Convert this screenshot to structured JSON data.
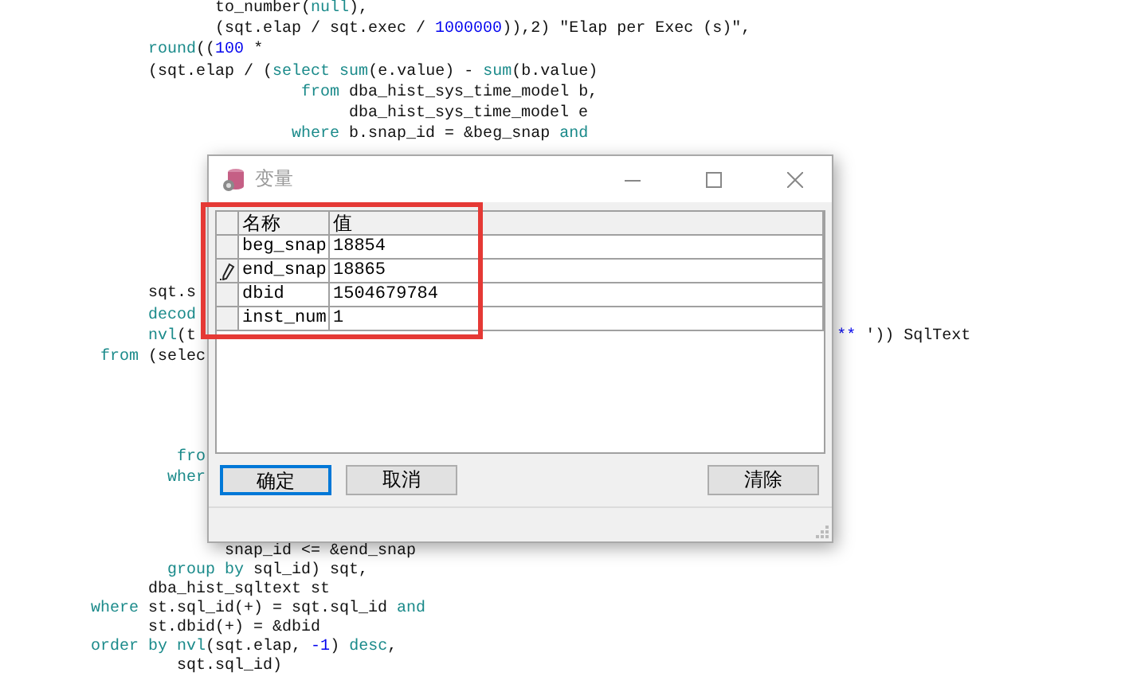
{
  "editor": {
    "blocks": [
      {
        "lines": [
          {
            "tokens": [
              {
                "t": "                     to_number(",
                "kind": "plain"
              },
              {
                "t": "null",
                "kind": "keyword"
              },
              {
                "t": "),",
                "kind": "plain"
              }
            ]
          },
          {
            "tokens": [
              {
                "t": "                     (sqt.elap / sqt.exec / ",
                "kind": "plain"
              },
              {
                "t": "1000000",
                "kind": "number"
              },
              {
                "t": ")),2) \"Elap per Exec (s)\",",
                "kind": "plain"
              }
            ]
          },
          {
            "tokens": [
              {
                "t": "              round",
                "kind": "keyword"
              },
              {
                "t": "((",
                "kind": "plain"
              },
              {
                "t": "100",
                "kind": "number"
              },
              {
                "t": " *",
                "kind": "plain"
              }
            ]
          },
          {
            "tokens": [
              {
                "t": "              (sqt.elap / (",
                "kind": "plain"
              },
              {
                "t": "select",
                "kind": "keyword"
              },
              {
                "t": " sum",
                "kind": "keyword"
              },
              {
                "t": "(e.value) - ",
                "kind": "plain"
              },
              {
                "t": "sum",
                "kind": "keyword"
              },
              {
                "t": "(b.value)",
                "kind": "plain"
              }
            ]
          },
          {
            "tokens": [
              {
                "t": "                              from",
                "kind": "keyword"
              },
              {
                "t": " dba_hist_sys_time_model b,",
                "kind": "plain"
              }
            ]
          },
          {
            "tokens": [
              {
                "t": "                                   dba_hist_sys_time_model e",
                "kind": "plain"
              }
            ]
          },
          {
            "tokens": [
              {
                "t": "                             where",
                "kind": "keyword"
              },
              {
                "t": " b.snap_id = &beg_snap ",
                "kind": "plain"
              },
              {
                "t": "and",
                "kind": "keyword"
              }
            ]
          }
        ]
      },
      {
        "lines": [
          {
            "tokens": [
              {
                "t": "              sqt.s",
                "kind": "plain"
              }
            ]
          },
          {
            "tokens": [
              {
                "t": "              decod",
                "kind": "keyword"
              }
            ]
          },
          {
            "tokens": [
              {
                "t": "              nvl",
                "kind": "keyword"
              },
              {
                "t": "(t",
                "kind": "plain"
              }
            ],
            "right": [
              {
                "t": "**",
                "kind": "number"
              },
              {
                "t": " ')) SqlText",
                "kind": "plain"
              }
            ]
          },
          {
            "tokens": [
              {
                "t": "         from",
                "kind": "keyword"
              },
              {
                "t": " (selec",
                "kind": "plain"
              }
            ]
          }
        ]
      },
      {
        "lines": [
          {
            "tokens": [
              {
                "t": "                 fro",
                "kind": "keyword"
              }
            ]
          },
          {
            "tokens": [
              {
                "t": "                wher",
                "kind": "keyword"
              }
            ]
          }
        ]
      },
      {
        "lines": [
          {
            "tokens": [
              {
                "t": "                      snap_id <= &end_snap",
                "kind": "plain"
              }
            ]
          },
          {
            "tokens": [
              {
                "t": "                group by",
                "kind": "keyword"
              },
              {
                "t": " sql_id) sqt,",
                "kind": "plain"
              }
            ]
          },
          {
            "tokens": [
              {
                "t": "              dba_hist_sqltext st",
                "kind": "plain"
              }
            ]
          },
          {
            "tokens": [
              {
                "t": "        where",
                "kind": "keyword"
              },
              {
                "t": " st.sql_id(+) = sqt.sql_id ",
                "kind": "plain"
              },
              {
                "t": "and",
                "kind": "keyword"
              }
            ]
          },
          {
            "tokens": [
              {
                "t": "              st.dbid(+) = &dbid",
                "kind": "plain"
              }
            ]
          },
          {
            "tokens": [
              {
                "t": "        order by nvl",
                "kind": "keyword"
              },
              {
                "t": "(sqt.elap, ",
                "kind": "plain"
              },
              {
                "t": "-1",
                "kind": "number"
              },
              {
                "t": ") ",
                "kind": "plain"
              },
              {
                "t": "desc",
                "kind": "keyword"
              },
              {
                "t": ",",
                "kind": "plain"
              }
            ]
          },
          {
            "tokens": [
              {
                "t": "                 sqt.sql_id)",
                "kind": "plain"
              }
            ]
          }
        ]
      }
    ]
  },
  "dialog": {
    "title": "变量",
    "grid": {
      "columns": [
        "名称",
        "值"
      ],
      "rows": [
        {
          "name": "beg_snap",
          "value": "18854",
          "editing": false
        },
        {
          "name": "end_snap",
          "value": "18865",
          "editing": true
        },
        {
          "name": "dbid",
          "value": "1504679784",
          "editing": false
        },
        {
          "name": "inst_num",
          "value": "1",
          "editing": false
        }
      ]
    },
    "buttons": [
      {
        "label": "确定",
        "focused": true
      },
      {
        "label": "取消",
        "focused": false
      }
    ],
    "clear_button": "清除",
    "highlight_box": true
  }
}
